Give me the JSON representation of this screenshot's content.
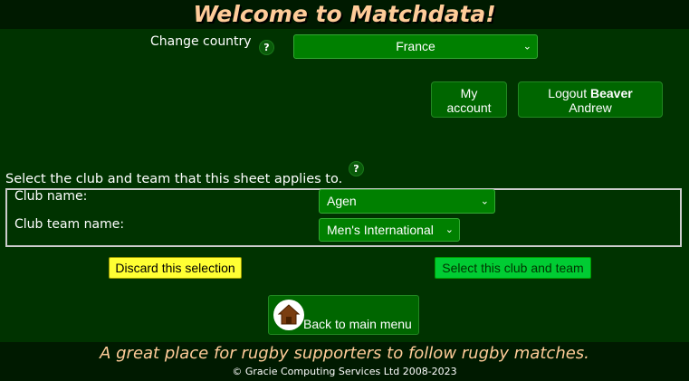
{
  "header": {
    "title": "Welcome to Matchdata!"
  },
  "country": {
    "label": "Change country",
    "help": "?",
    "selected": "France"
  },
  "account": {
    "my_account_line1": "My",
    "my_account_line2": "account",
    "logout_prefix": "Logout ",
    "user_surname": "Beaver",
    "user_firstname": "Andrew"
  },
  "selection": {
    "help": "?",
    "instruction": "Select the club and team that this sheet applies to.",
    "club_label": "Club name:",
    "club_value": "Agen",
    "team_label": "Club team name:",
    "team_value": "Men's International",
    "discard_label": "Discard this selection",
    "select_label": "Select this club and team"
  },
  "nav": {
    "back_label": "Back to main menu"
  },
  "footer": {
    "tagline": "A great place for rugby supporters to follow rugby matches.",
    "copyright": "© Gracie Computing Services Ltd 2008-2023"
  },
  "colors": {
    "background": "#003300",
    "header_bg": "#001a00",
    "title": "#ffcc99",
    "select_bg": "#008000",
    "discard_bg": "#ffff33",
    "confirm_bg": "#00cc33"
  }
}
